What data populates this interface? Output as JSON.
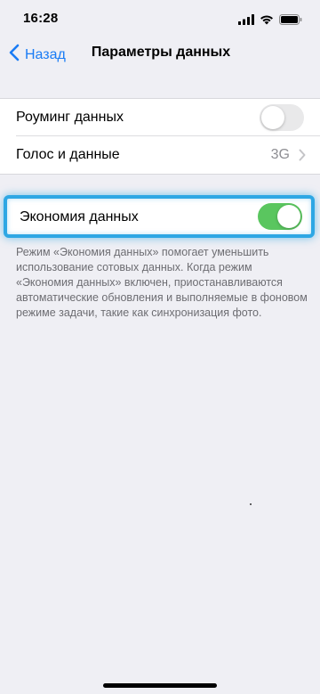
{
  "status": {
    "time": "16:28",
    "icons": [
      "cellular-signal-icon",
      "wifi-icon",
      "battery-icon"
    ]
  },
  "nav": {
    "back_label": "Назад",
    "title": "Параметры данных"
  },
  "settings": {
    "roaming": {
      "label": "Роуминг данных",
      "enabled": false
    },
    "voice_data": {
      "label": "Голос и данные",
      "value": "3G"
    },
    "low_data": {
      "label": "Экономия данных",
      "enabled": true
    }
  },
  "footer": {
    "text": "Режим «Экономия данных» помогает уменьшить использование сотовых данных. Когда режим «Экономия данных» включен, приостанавливаются автоматические обновления и выполняемые в фоновом режиме задачи, такие как синхронизация фото."
  },
  "colors": {
    "accent": "#1a7cf5",
    "toggle_on": "#5ac65f",
    "highlight": "#2ea7e4",
    "background": "#efeff4"
  }
}
